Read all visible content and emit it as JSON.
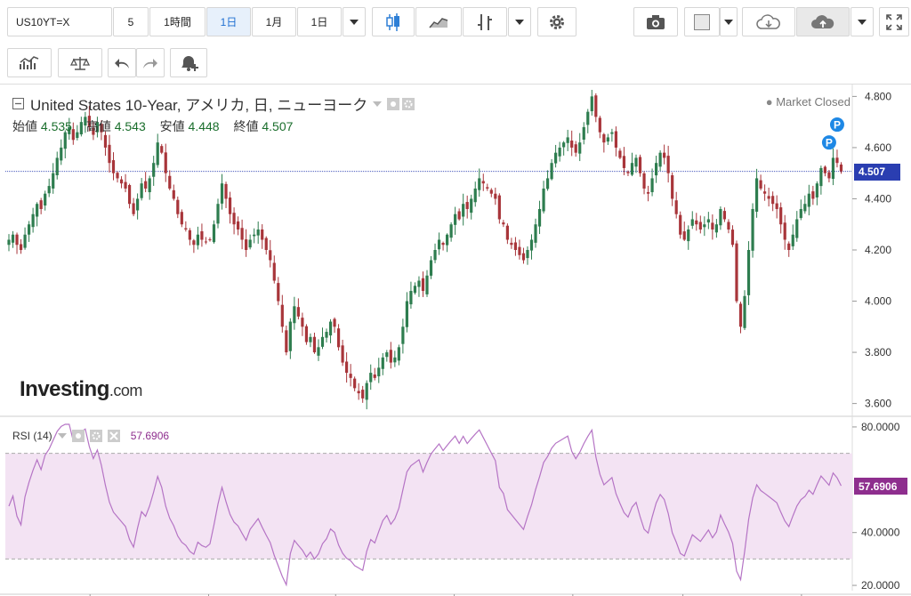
{
  "toolbar": {
    "symbol": "US10YT=X",
    "interval_buttons": [
      "5",
      "1時間",
      "1日",
      "1月",
      "1日"
    ],
    "active_interval_index": 2
  },
  "chart": {
    "title": "United States 10-Year, アメリカ, 日, ニューヨーク",
    "market_status": "Market Closed",
    "ohlc": {
      "open_label": "始値",
      "open": "4.535",
      "high_label": "高値",
      "high": "4.543",
      "low_label": "安値",
      "low": "4.448",
      "close_label": "終値",
      "close": "4.507"
    },
    "logo_main": "Investing",
    "logo_suffix": ".com",
    "last_price_tag": "4.507",
    "markers": [
      "P",
      "P"
    ],
    "colors": {
      "up": "#2e7d4f",
      "down": "#a8353a",
      "last_line": "#2a3eb1",
      "rsi_line": "#b574c5",
      "rsi_band": "#f3e3f3",
      "rsi_tag": "#8e2e8e",
      "price_tag": "#2a3eb1",
      "marker": "#1e88e5"
    }
  },
  "rsi": {
    "label": "RSI (14)",
    "value": "57.6906",
    "tag": "57.6906"
  },
  "chart_data": [
    {
      "type": "candlestick",
      "ylim": [
        3.55,
        4.85
      ],
      "yticks": [
        "4.800",
        "4.600",
        "4.400",
        "4.200",
        "4.000",
        "3.800",
        "3.600"
      ],
      "ytick_values": [
        4.8,
        4.6,
        4.4,
        4.2,
        4.0,
        3.8,
        3.6
      ],
      "last": 4.507,
      "closes": [
        4.24,
        4.26,
        4.22,
        4.2,
        4.26,
        4.3,
        4.34,
        4.38,
        4.36,
        4.42,
        4.45,
        4.5,
        4.56,
        4.6,
        4.66,
        4.68,
        4.63,
        4.66,
        4.7,
        4.72,
        4.68,
        4.65,
        4.7,
        4.66,
        4.6,
        4.54,
        4.5,
        4.48,
        4.46,
        4.44,
        4.38,
        4.34,
        4.4,
        4.46,
        4.44,
        4.48,
        4.54,
        4.62,
        4.58,
        4.5,
        4.44,
        4.4,
        4.34,
        4.3,
        4.28,
        4.24,
        4.22,
        4.26,
        4.24,
        4.23,
        4.24,
        4.3,
        4.38,
        4.46,
        4.4,
        4.34,
        4.3,
        4.28,
        4.24,
        4.2,
        4.24,
        4.26,
        4.28,
        4.24,
        4.2,
        4.16,
        4.08,
        4.0,
        3.9,
        3.8,
        3.92,
        3.98,
        3.94,
        3.9,
        3.84,
        3.86,
        3.8,
        3.82,
        3.86,
        3.88,
        3.92,
        3.9,
        3.82,
        3.76,
        3.72,
        3.7,
        3.66,
        3.64,
        3.62,
        3.68,
        3.72,
        3.7,
        3.74,
        3.78,
        3.8,
        3.76,
        3.78,
        3.82,
        3.9,
        4.0,
        4.04,
        4.06,
        4.08,
        4.04,
        4.1,
        4.16,
        4.2,
        4.24,
        4.22,
        4.26,
        4.3,
        4.34,
        4.32,
        4.38,
        4.36,
        4.4,
        4.44,
        4.48,
        4.46,
        4.44,
        4.42,
        4.4,
        4.32,
        4.3,
        4.24,
        4.22,
        4.2,
        4.18,
        4.16,
        4.2,
        4.24,
        4.3,
        4.36,
        4.44,
        4.48,
        4.54,
        4.58,
        4.6,
        4.62,
        4.64,
        4.6,
        4.58,
        4.62,
        4.68,
        4.74,
        4.8,
        4.72,
        4.66,
        4.62,
        4.64,
        4.66,
        4.6,
        4.56,
        4.52,
        4.5,
        4.54,
        4.56,
        4.5,
        4.44,
        4.42,
        4.48,
        4.54,
        4.58,
        4.56,
        4.5,
        4.4,
        4.34,
        4.26,
        4.24,
        4.28,
        4.32,
        4.3,
        4.28,
        4.3,
        4.32,
        4.28,
        4.3,
        4.36,
        4.32,
        4.28,
        4.22,
        4.0,
        3.9,
        4.02,
        4.2,
        4.36,
        4.48,
        4.44,
        4.42,
        4.4,
        4.38,
        4.36,
        4.3,
        4.24,
        4.2,
        4.26,
        4.32,
        4.36,
        4.38,
        4.42,
        4.4,
        4.46,
        4.52,
        4.5,
        4.48,
        4.56,
        4.54,
        4.507
      ]
    },
    {
      "type": "line",
      "name": "RSI (14)",
      "ylim": [
        18,
        82
      ],
      "yticks": [
        "80.0000",
        "40.0000",
        "20.0000"
      ],
      "ytick_values": [
        80,
        40,
        20
      ],
      "bands": [
        30,
        70
      ],
      "last": 57.6906
    }
  ]
}
